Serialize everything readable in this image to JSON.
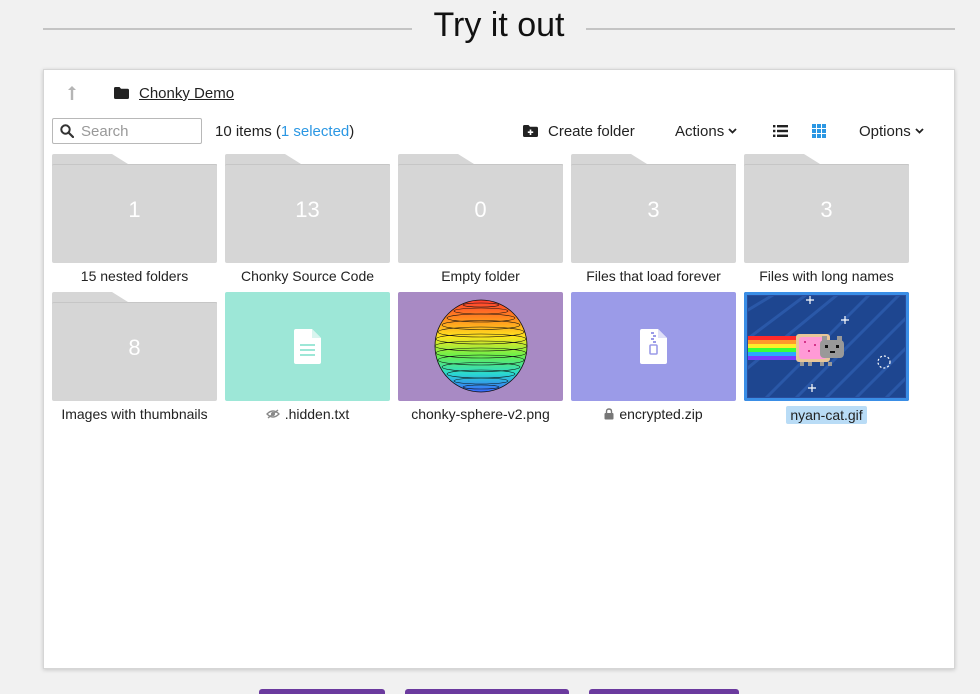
{
  "hero": {
    "title": "Try it out"
  },
  "breadcrumb": {
    "root": "Chonky Demo"
  },
  "toolbar": {
    "search_placeholder": "Search",
    "item_count": "10 items",
    "paren_open": " (",
    "selected_text": "1 selected",
    "paren_close": ")",
    "create_folder": "Create folder",
    "actions": "Actions",
    "options": "Options"
  },
  "files": [
    {
      "type": "folder",
      "count": "1",
      "name": "15 nested folders"
    },
    {
      "type": "folder",
      "count": "13",
      "name": "Chonky Source Code"
    },
    {
      "type": "folder",
      "count": "0",
      "name": "Empty folder"
    },
    {
      "type": "folder",
      "count": "3",
      "name": "Files that load forever"
    },
    {
      "type": "folder",
      "count": "3",
      "name": "Files with long names"
    },
    {
      "type": "folder",
      "count": "8",
      "name": "Images with thumbnails"
    },
    {
      "type": "text-file",
      "name": ".hidden.txt",
      "modifier": "hidden-icon",
      "color": "#9de7d7"
    },
    {
      "type": "image",
      "name": "chonky-sphere-v2.png",
      "color": "#a88ac4"
    },
    {
      "type": "archive",
      "name": "encrypted.zip",
      "modifier": "lock-icon",
      "color": "#9b9be8"
    },
    {
      "type": "image",
      "name": "nyan-cat.gif",
      "selected": true,
      "color": "#2a4d9c"
    }
  ],
  "colors": {
    "accent": "#2b97e3",
    "folder": "#d6d6d6",
    "brand": "#6b3a9e"
  }
}
